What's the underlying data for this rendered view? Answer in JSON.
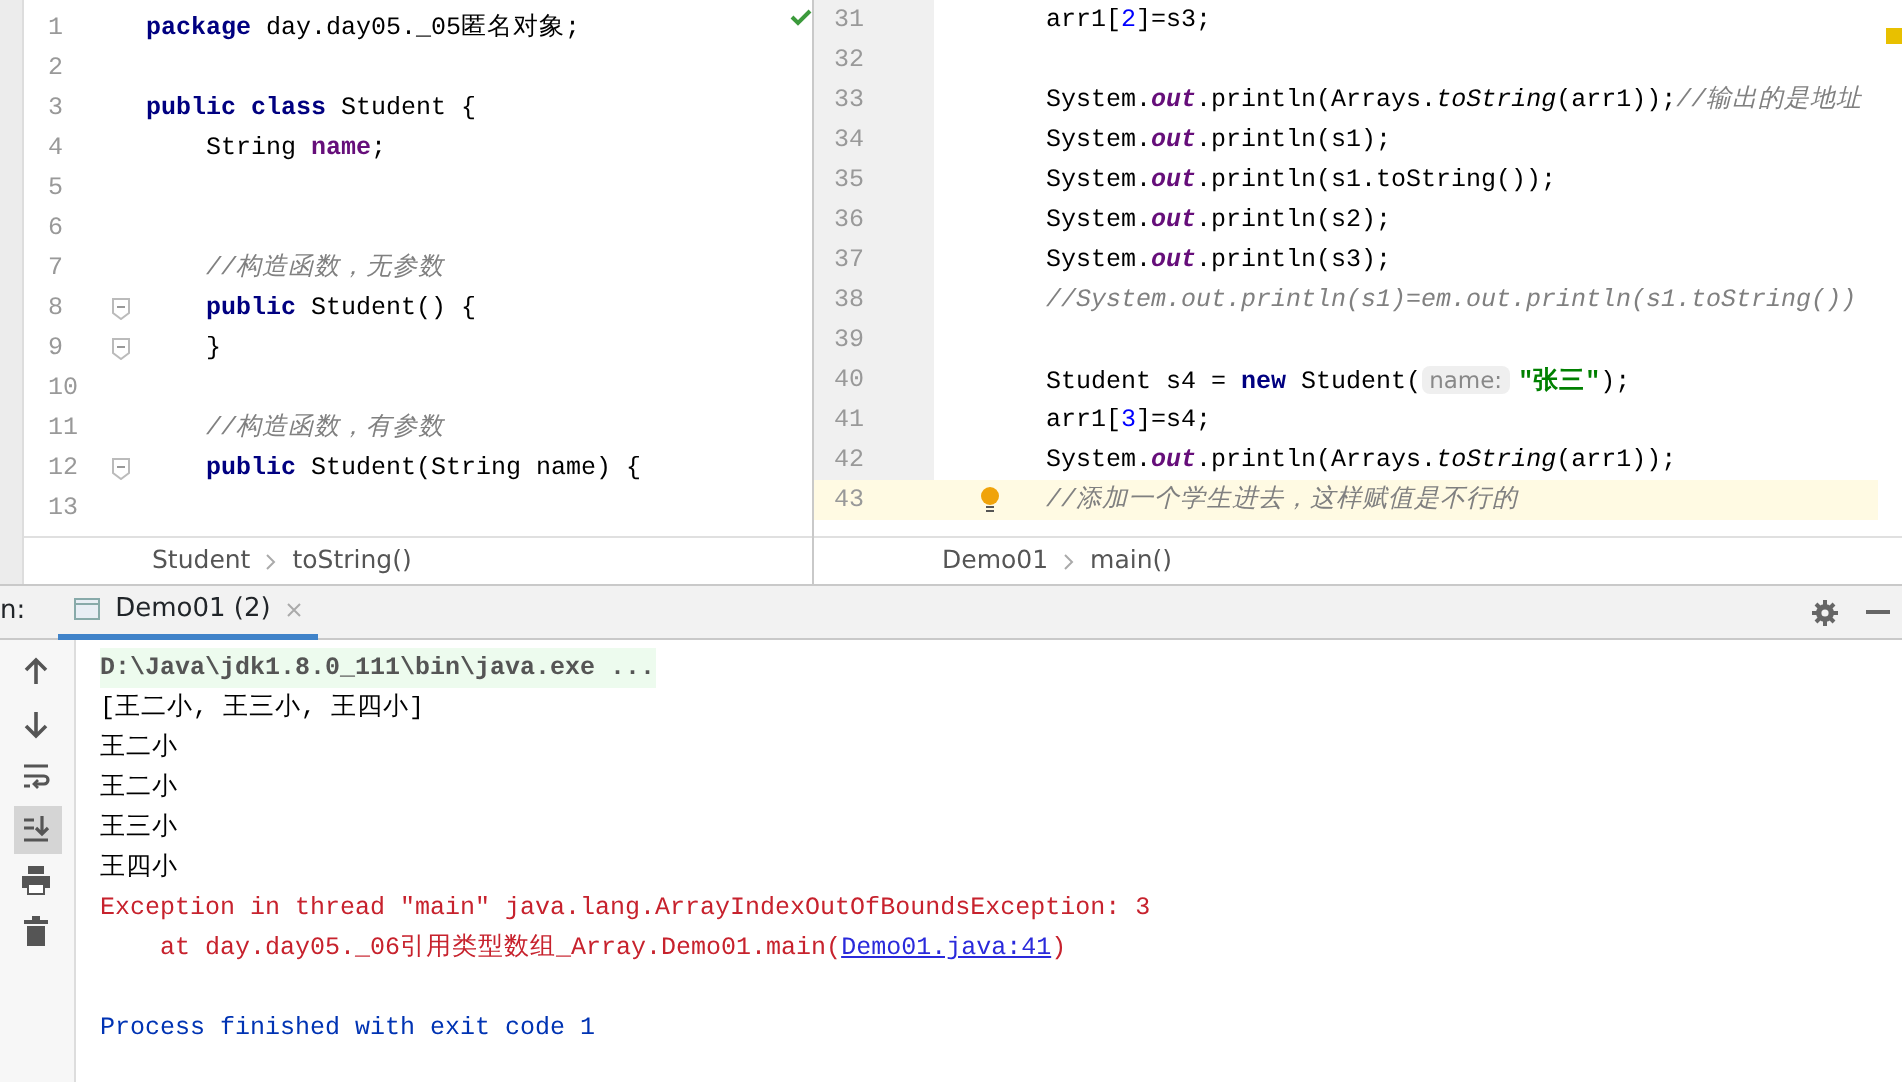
{
  "left_editor": {
    "lines": [
      {
        "number": "1",
        "fold": false,
        "segments": [
          {
            "kind": "kw",
            "text": "package"
          },
          {
            "kind": "plain",
            "text": " day.day05._05匿名对象;"
          }
        ]
      },
      {
        "number": "2",
        "fold": false
      },
      {
        "number": "3",
        "fold": false,
        "segments": [
          {
            "kind": "kw",
            "text": "public class"
          },
          {
            "kind": "plain",
            "text": " Student {"
          }
        ]
      },
      {
        "number": "4",
        "fold": false,
        "segments": [
          {
            "kind": "plain",
            "text": "    String "
          },
          {
            "kind": "field",
            "text": "name"
          },
          {
            "kind": "plain",
            "text": ";"
          }
        ]
      },
      {
        "number": "5",
        "fold": false
      },
      {
        "number": "6",
        "fold": false
      },
      {
        "number": "7",
        "fold": false,
        "segments": [
          {
            "kind": "comment",
            "text": "    //构造函数，无参数"
          }
        ]
      },
      {
        "number": "8",
        "fold": true,
        "segments": [
          {
            "kind": "kw",
            "text": "    public"
          },
          {
            "kind": "plain",
            "text": " Student() {"
          }
        ]
      },
      {
        "number": "9",
        "fold": true,
        "segments": [
          {
            "kind": "plain",
            "text": "    }"
          }
        ]
      },
      {
        "number": "10",
        "fold": false
      },
      {
        "number": "11",
        "fold": false,
        "segments": [
          {
            "kind": "comment",
            "text": "    //构造函数，有参数"
          }
        ]
      },
      {
        "number": "12",
        "fold": true,
        "segments": [
          {
            "kind": "kw",
            "text": "    public"
          },
          {
            "kind": "plain",
            "text": " Student(String name) {"
          }
        ]
      },
      {
        "number": "13",
        "fold": false
      }
    ],
    "breadcrumb": [
      "Student",
      "toString()"
    ]
  },
  "right_editor": {
    "lines": [
      {
        "number": "31",
        "current": false,
        "segments": [
          {
            "kind": "plain",
            "text": "arr1["
          },
          {
            "kind": "num",
            "text": "2"
          },
          {
            "kind": "plain",
            "text": "]=s3;"
          }
        ]
      },
      {
        "number": "32",
        "current": false
      },
      {
        "number": "33",
        "current": false,
        "segments": [
          {
            "kind": "plain",
            "text": "System."
          },
          {
            "kind": "static",
            "text": "out"
          },
          {
            "kind": "plain",
            "text": ".println(Arrays."
          },
          {
            "kind": "method",
            "text": "toString"
          },
          {
            "kind": "plain",
            "text": "(arr1));"
          },
          {
            "kind": "comment",
            "text": "//输出的是地址"
          }
        ]
      },
      {
        "number": "34",
        "current": false,
        "segments": [
          {
            "kind": "plain",
            "text": "System."
          },
          {
            "kind": "static",
            "text": "out"
          },
          {
            "kind": "plain",
            "text": ".println(s1);"
          }
        ]
      },
      {
        "number": "35",
        "current": false,
        "segments": [
          {
            "kind": "plain",
            "text": "System."
          },
          {
            "kind": "static",
            "text": "out"
          },
          {
            "kind": "plain",
            "text": ".println(s1.toString());"
          }
        ]
      },
      {
        "number": "36",
        "current": false,
        "segments": [
          {
            "kind": "plain",
            "text": "System."
          },
          {
            "kind": "static",
            "text": "out"
          },
          {
            "kind": "plain",
            "text": ".println(s2);"
          }
        ]
      },
      {
        "number": "37",
        "current": false,
        "segments": [
          {
            "kind": "plain",
            "text": "System."
          },
          {
            "kind": "static",
            "text": "out"
          },
          {
            "kind": "plain",
            "text": ".println(s3);"
          }
        ]
      },
      {
        "number": "38",
        "current": false,
        "segments": [
          {
            "kind": "comment",
            "text": "//System.out.println(s1)=em.out.println(s1.toString())"
          }
        ]
      },
      {
        "number": "39",
        "current": false
      },
      {
        "number": "40",
        "current": false,
        "segments": [
          {
            "kind": "plain",
            "text": "Student s4 = "
          },
          {
            "kind": "kw",
            "text": "new"
          },
          {
            "kind": "plain",
            "text": " Student("
          },
          {
            "kind": "hint",
            "text": "name:"
          },
          {
            "kind": "str",
            "text": "\"张三\""
          },
          {
            "kind": "plain",
            "text": ");"
          }
        ]
      },
      {
        "number": "41",
        "current": false,
        "segments": [
          {
            "kind": "plain",
            "text": "arr1["
          },
          {
            "kind": "num",
            "text": "3"
          },
          {
            "kind": "plain",
            "text": "]=s4;"
          }
        ]
      },
      {
        "number": "42",
        "current": false,
        "segments": [
          {
            "kind": "plain",
            "text": "System."
          },
          {
            "kind": "static",
            "text": "out"
          },
          {
            "kind": "plain",
            "text": ".println(Arrays."
          },
          {
            "kind": "method",
            "text": "toString"
          },
          {
            "kind": "plain",
            "text": "(arr1));"
          }
        ]
      },
      {
        "number": "43",
        "current": true,
        "segments": [
          {
            "kind": "comment",
            "text": "//添加一个学生进去，这样赋值是不行的"
          }
        ]
      }
    ],
    "breadcrumb": [
      "Demo01",
      "main()"
    ]
  },
  "run_panel": {
    "label": "n:",
    "tabs": [
      {
        "label": "Demo01 (2)",
        "selected": true
      }
    ],
    "tools": [
      {
        "kind": "up",
        "selected": false
      },
      {
        "kind": "down",
        "selected": false
      },
      {
        "kind": "wrap",
        "selected": false
      },
      {
        "kind": "scroll-end",
        "selected": true
      },
      {
        "kind": "print",
        "selected": false
      },
      {
        "kind": "trash",
        "selected": false
      }
    ],
    "output": [
      {
        "kind": "cmd",
        "segments": [
          {
            "kind": "text",
            "text": "D:\\Java\\jdk1.8.0_111\\bin\\java.exe ..."
          }
        ]
      },
      {
        "kind": "out",
        "segments": [
          {
            "kind": "text",
            "text": "[王二小, 王三小, 王四小]"
          }
        ]
      },
      {
        "kind": "out",
        "segments": [
          {
            "kind": "text",
            "text": "王二小"
          }
        ]
      },
      {
        "kind": "out",
        "segments": [
          {
            "kind": "text",
            "text": "王二小"
          }
        ]
      },
      {
        "kind": "out",
        "segments": [
          {
            "kind": "text",
            "text": "王三小"
          }
        ]
      },
      {
        "kind": "out",
        "segments": [
          {
            "kind": "text",
            "text": "王四小"
          }
        ]
      },
      {
        "kind": "err",
        "segments": [
          {
            "kind": "text",
            "text": "Exception in thread \"main\" java.lang.ArrayIndexOutOfBoundsException: 3"
          }
        ]
      },
      {
        "kind": "err",
        "segments": [
          {
            "kind": "text",
            "text": "    at day.day05._06引用类型数组_Array.Demo01.main("
          },
          {
            "kind": "link",
            "text": "Demo01.java:41"
          },
          {
            "kind": "text",
            "text": ")"
          }
        ]
      },
      {
        "kind": "blank"
      },
      {
        "kind": "exit",
        "segments": [
          {
            "kind": "text",
            "text": "Process finished with exit code 1"
          }
        ]
      }
    ]
  }
}
